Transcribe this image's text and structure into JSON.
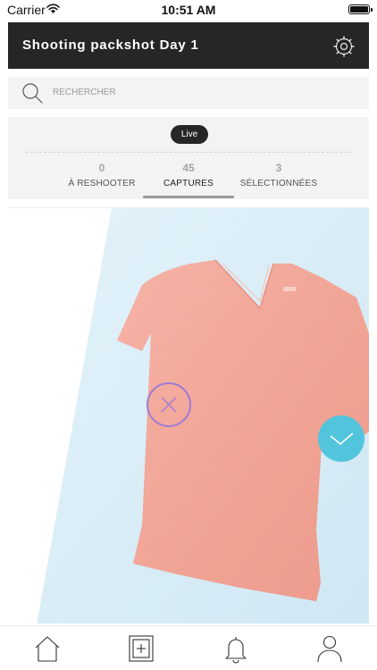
{
  "status_bar": {
    "carrier": "Carrier",
    "time": "10:51 AM"
  },
  "header": {
    "title": "Shooting packshot Day 1",
    "settings_icon": "gear-icon"
  },
  "search": {
    "placeholder": "RECHERCHER",
    "icon": "search-icon"
  },
  "stats": {
    "live_label": "Live",
    "tabs": [
      {
        "count": "0",
        "label": "À RESHOOTER"
      },
      {
        "count": "45",
        "label": "CAPTURES"
      },
      {
        "count": "3",
        "label": "SÉLECTIONNÉES"
      }
    ],
    "active_tab": "CAPTURES"
  },
  "photo": {
    "subject": "coral v-neck t-shirt",
    "reject_icon": "close-icon",
    "accept_icon": "check-icon",
    "colors": {
      "reject": "#9f7ad6",
      "accept": "#52c4dc",
      "backdrop": "#d6ecf6"
    }
  },
  "tab_bar": {
    "icons": [
      "home-icon",
      "add-photo-icon",
      "bell-icon",
      "profile-icon"
    ]
  },
  "colors": {
    "header_bg": "#262626",
    "panel_bg": "#f3f3f3"
  }
}
